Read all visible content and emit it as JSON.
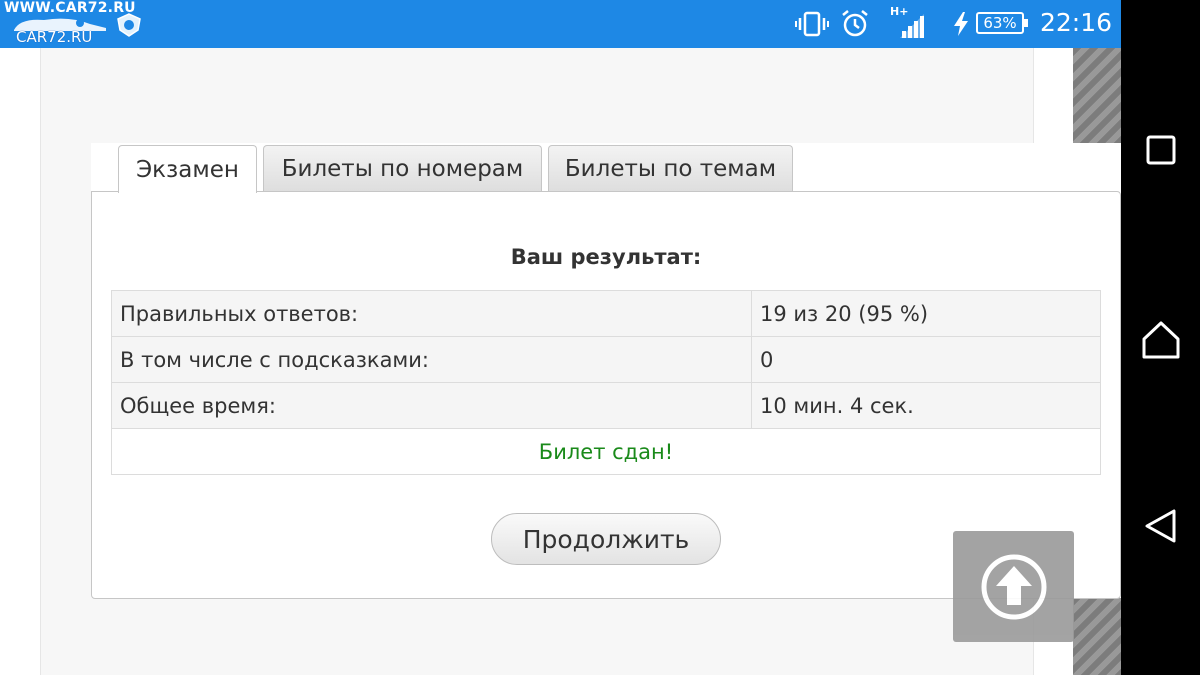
{
  "status_bar": {
    "logo_top": "WWW.CAR72.RU",
    "logo_bottom": "CAR72.RU",
    "network_label": "H+",
    "battery": "63%",
    "time": "22:16"
  },
  "tabs": [
    {
      "label": "Экзамен",
      "active": true
    },
    {
      "label": "Билеты по номерам",
      "active": false
    },
    {
      "label": "Билеты по темам",
      "active": false
    }
  ],
  "result": {
    "title": "Ваш результат:",
    "rows": [
      {
        "label": "Правильных ответов:",
        "value": "19 из 20 (95 %)"
      },
      {
        "label": "В том числе с подсказками:",
        "value": "0"
      },
      {
        "label": "Общее время:",
        "value": "10 мин. 4 сек."
      }
    ],
    "status": "Билет сдан!",
    "status_color": "#1a8a1a"
  },
  "continue_label": "Продолжить",
  "icons": {
    "vibrate": "vibrate-icon",
    "alarm": "alarm-icon",
    "signal": "signal-icon",
    "charging": "charging-icon",
    "scroll_top": "arrow-up-circle-icon",
    "recents": "recents-square-icon",
    "home": "home-icon",
    "back": "back-triangle-icon"
  },
  "colors": {
    "status_bar": "#1e88e5",
    "nav_bar": "#000000"
  }
}
